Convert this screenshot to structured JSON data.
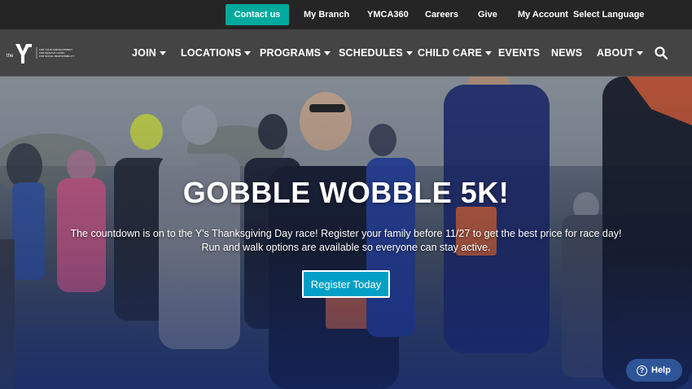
{
  "utility_bar": {
    "contact_label": "Contact us",
    "links": [
      "My Branch",
      "YMCA360",
      "Careers",
      "Give",
      "My Account",
      "Select Language"
    ]
  },
  "logo": {
    "wordmark": "the Y",
    "tagline_lines": [
      "FOR YOUTH DEVELOPMENT",
      "FOR HEALTHY LIVING",
      "FOR SOCIAL RESPONSIBILITY"
    ]
  },
  "nav": {
    "items": [
      {
        "label": "JOIN"
      },
      {
        "label": "LOCATIONS"
      },
      {
        "label": "PROGRAMS"
      },
      {
        "label": "SCHEDULES"
      },
      {
        "label": "CHILD CARE"
      },
      {
        "label": "EVENTS"
      },
      {
        "label": "NEWS"
      },
      {
        "label": "ABOUT"
      }
    ],
    "search_icon": "search-icon"
  },
  "hero": {
    "title": "GOBBLE WOBBLE 5K!",
    "description": "The countdown is on to the Y's Thanksgiving Day race! Register your family before 11/27 to get the best price for race day! Run and walk options are available so everyone can stay active.",
    "cta_label": "Register Today"
  },
  "help": {
    "label": "Help",
    "icon": "question-circle-icon"
  },
  "colors": {
    "accent_teal": "#00a99d",
    "cta_blue": "#00a0c6",
    "help_blue": "#2e5597",
    "topbar_bg": "#252525",
    "navbar_bg": "#464646"
  }
}
